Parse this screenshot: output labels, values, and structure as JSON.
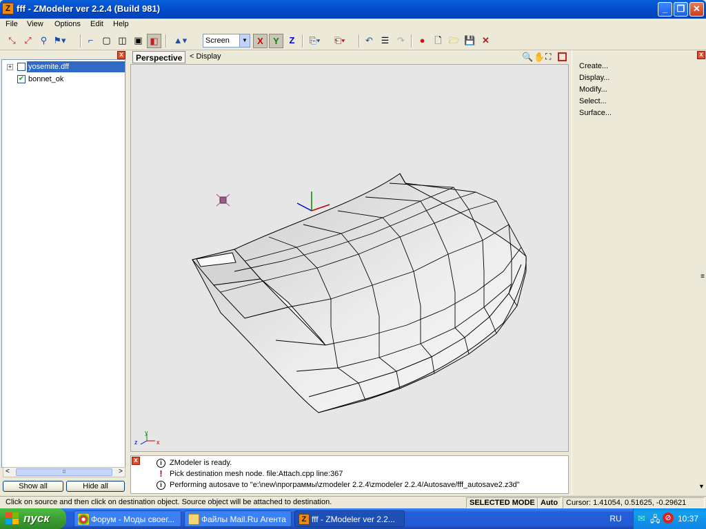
{
  "window": {
    "title": "fff - ZModeler ver 2.2.4 (Build 981)",
    "app_icon_letter": "Z",
    "minimize": "_",
    "maximize": "❐",
    "close": "✕"
  },
  "menu": [
    "File",
    "View",
    "Options",
    "Edit",
    "Help"
  ],
  "toolbar": {
    "coord_mode": "Screen",
    "axis_x": "X",
    "axis_y": "Y",
    "axis_z": "Z",
    "colors": {
      "x": "#cc0000",
      "y": "#008800",
      "z": "#0000cc"
    }
  },
  "tree": {
    "items": [
      {
        "label": "yosemite.dff",
        "checked": false,
        "selected": true
      },
      {
        "label": "bonnet_ok",
        "checked": true,
        "selected": false
      }
    ],
    "show_all": "Show all",
    "hide_all": "Hide all"
  },
  "viewport": {
    "view_name": "Perspective",
    "display_menu": "<  Display",
    "axis_labels": {
      "z": "z",
      "y": "y",
      "x": "x"
    }
  },
  "messages": [
    {
      "icon": "info",
      "text": "ZModeler is ready."
    },
    {
      "icon": "warning",
      "text": "Pick destination mesh node. file:Attach.cpp line:367"
    },
    {
      "icon": "info",
      "text": "Performing autosave to \"e:\\new\\программы\\zmodeler 2.2.4\\zmodeler 2.2.4/Autosave/fff_autosave2.z3d\""
    }
  ],
  "command_panel": [
    "Create...",
    "Display...",
    "Modify...",
    "Select...",
    "Surface..."
  ],
  "status": {
    "hint": "Click on source and then click on destination object. Source object will be attached to destination.",
    "mode": "SELECTED MODE",
    "auto": "Auto",
    "cursor": "Cursor: 1.41054, 0.51625, -0.29621"
  },
  "taskbar": {
    "start": "пуск",
    "tasks": [
      {
        "label": "Форум - Моды своег...",
        "active": false
      },
      {
        "label": "Файлы Mail.Ru Агента",
        "active": false
      },
      {
        "label": "fff - ZModeler ver 2.2...",
        "active": true
      }
    ],
    "lang": "RU",
    "clock": "10:37"
  }
}
